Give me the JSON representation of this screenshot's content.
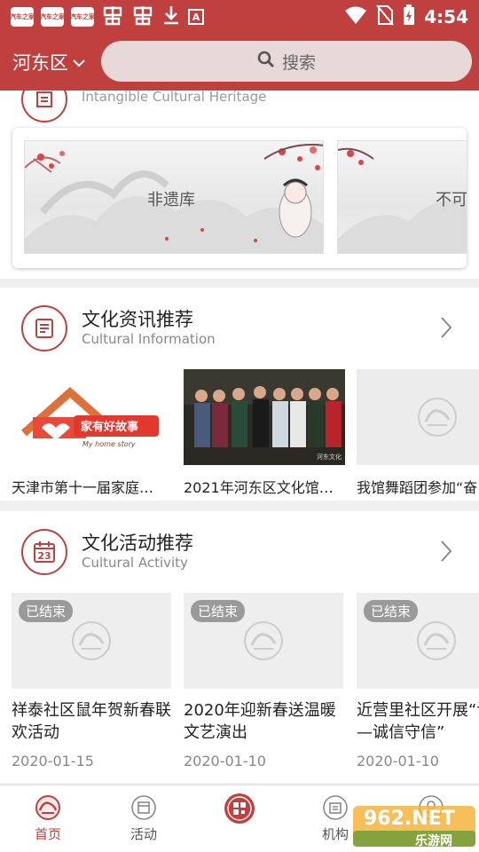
{
  "status_bar": {
    "app_icon_1": "汽车之家",
    "app_icon_2": "汽车之家",
    "app_icon_3": "汽车之家",
    "a_icon": "A",
    "time": "4:54"
  },
  "header": {
    "district": "河东区",
    "search_placeholder": "搜索"
  },
  "heritage": {
    "subtitle": "Intangible Cultural Heritage",
    "banners": [
      {
        "label": "非遗库"
      },
      {
        "label": "不可"
      }
    ]
  },
  "cultural_info": {
    "title": "文化资讯推荐",
    "subtitle": "Cultural Information",
    "items": [
      {
        "title": "天津市第十一届家庭…",
        "logo_text": "家有好故事",
        "logo_en": "My home story"
      },
      {
        "title": "2021年河东区文化馆…",
        "watermark": "河东文化"
      },
      {
        "title": "我馆舞蹈团参加“奋"
      }
    ]
  },
  "cultural_activity": {
    "title": "文化活动推荐",
    "subtitle": "Cultural Activity",
    "calendar_day": "23",
    "items": [
      {
        "badge": "已结束",
        "title": "祥泰社区鼠年贺新春联欢活动",
        "date": "2020-01-15"
      },
      {
        "badge": "已结束",
        "title": "2020年迎新春送温暖文艺演出",
        "date": "2020-01-10"
      },
      {
        "badge": "已结束",
        "title": "近营里社区开展“讲堂—诚信守信”",
        "date": "2020-01-10"
      }
    ]
  },
  "bottom_nav": {
    "items": [
      {
        "label": "首页",
        "active": true
      },
      {
        "label": "活动",
        "active": false
      },
      {
        "label": "",
        "active": false
      },
      {
        "label": "机构",
        "active": false
      },
      {
        "label": "",
        "active": false
      }
    ]
  },
  "watermark": {
    "text": "962.NET",
    "sub": "乐游网"
  },
  "colors": {
    "brand": "#c0403f",
    "badge": "#9a9a9a"
  }
}
